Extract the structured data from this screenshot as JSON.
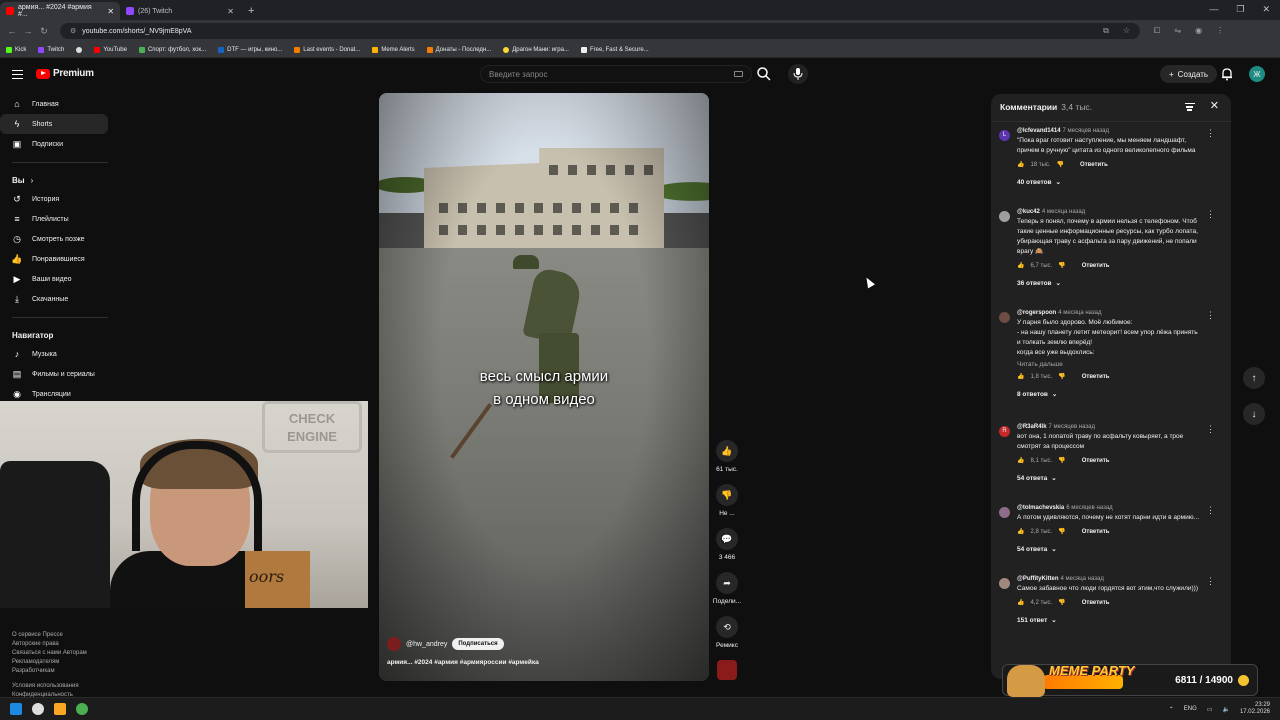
{
  "browser": {
    "tabs": [
      {
        "title": "армия... #2024 #армия #...",
        "active": true,
        "favicon_color": "#ff0000"
      },
      {
        "title": "(26) Twitch",
        "active": false,
        "favicon_color": "#9146ff"
      }
    ],
    "new_tab": "+",
    "url": "youtube.com/shorts/_NV9jmE8pVA",
    "bookmarks": [
      "Kick",
      "Twitch",
      "",
      "YouTube",
      "Спорт: футбол, хок...",
      "DTF — игры, кино...",
      "Last events - Donat...",
      "Meme Alerts",
      "Донаты - Последн...",
      "Драгон Мани: игра...",
      "Free, Fast & Secure..."
    ]
  },
  "youtube": {
    "logo_text": "Premium",
    "search_placeholder": "Введите запрос",
    "create_label": "Создать",
    "avatar_letter": "Ж"
  },
  "sidebar": {
    "items": [
      {
        "label": "Главная",
        "icon": "home-icon"
      },
      {
        "label": "Shorts",
        "icon": "shorts-icon",
        "active": true
      },
      {
        "label": "Подписки",
        "icon": "subscriptions-icon"
      }
    ],
    "you_heading": "Вы",
    "you_items": [
      "История",
      "Плейлисты",
      "Смотреть позже",
      "Понравившиеся",
      "Ваши видео",
      "Скачанные"
    ],
    "nav_heading": "Навигатор",
    "nav_items": [
      "Музыка",
      "Фильмы и сериалы",
      "Трансляции"
    ],
    "footer_lines": [
      "О сервисе  Прессе",
      "Авторские права",
      "Связаться с нами  Авторам",
      "Рекламодателям",
      "Разработчикам",
      "",
      "Условия использования",
      "Конфиденциальность"
    ]
  },
  "webcam": {
    "sign_text": "CHECK ENGINE",
    "box_text": "oors"
  },
  "video": {
    "subtitle_line1": "весь смысл армии",
    "subtitle_line2": "в одном видео",
    "channel": "@hw_andrey",
    "subscribe": "Подписаться",
    "title": "армия... #2024 #армия #армияроссии #армейка"
  },
  "actions": {
    "likes": "61 тыс.",
    "dislike": "Не ...",
    "comments": "3 466",
    "share": "Подели...",
    "remix": "Ремикс"
  },
  "comments": {
    "title": "Комментарии",
    "count": "3,4 тыс.",
    "items": [
      {
        "user": "@lcfevand1414",
        "time": "7 месяцев назад",
        "text": "\"Пока враг готовит наступление, мы меняем ландшафт,\nпричем в ручную\" цитата из одного великолепного фильма",
        "likes": "18 тыс.",
        "replies": "40 ответов",
        "avatar_color": "#5e35b1",
        "avatar_letter": "L"
      },
      {
        "user": "@kuc42",
        "time": "4 месяца назад",
        "text": "Теперь я понял, почему в армии нельзя с телефоном. Чтоб\nтакие ценные информационные ресурсы, как турбо лопата,\nубирающая траву с асфальта за пару движений, не попали\nврагу 🙈",
        "likes": "6,7 тыс.",
        "replies": "36 ответов",
        "avatar_color": "#9e9e9e",
        "avatar_letter": ""
      },
      {
        "user": "@rogerspoon",
        "time": "4 месяца назад",
        "text": "У парня было здорово. Моё любимое:\n- на нашу планету летит метеорит! всем упор лёжа принять\nи толкать землю вперёд!\nкогда все уже выдохлись:",
        "more": "Читать дальше",
        "likes": "1,8 тыс.",
        "replies": "8 ответов",
        "avatar_color": "#6d4c41",
        "avatar_letter": ""
      },
      {
        "user": "@R3aR4lk",
        "time": "7 месяцев назад",
        "text": "вот она, 1 лопатой траву по асфальту ковыряет, а трое\nсмотрят за процессом",
        "likes": "8,1 тыс.",
        "replies": "54 ответа",
        "avatar_color": "#c62828",
        "avatar_letter": "R"
      },
      {
        "user": "@tolmachevskia",
        "time": "6 месяцев назад",
        "text": "А потом удивляются, почему не хотят парни идти в армию...",
        "likes": "2,8 тыс.",
        "replies": "54 ответа",
        "avatar_color": "#8e6c8a",
        "avatar_letter": ""
      },
      {
        "user": "@PuffityKitten",
        "time": "4 месяца назад",
        "text": "Самое забавное что люди гордятся вот этим,что служили)))",
        "likes": "4,2 тыс.",
        "replies": "151 ответ",
        "avatar_color": "#a1887f",
        "avatar_letter": ""
      }
    ],
    "reply_label": "Ответить"
  },
  "overlay": {
    "meme_title": "MEME PARTY",
    "meme_count": "6811 / 14900"
  },
  "taskbar": {
    "lang": "ENG",
    "time": "23:29",
    "date": "17.02.2026"
  }
}
